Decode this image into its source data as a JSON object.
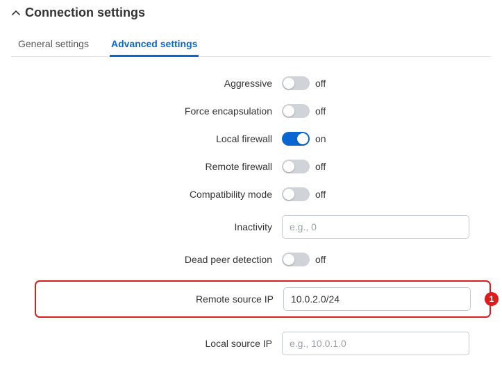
{
  "section": {
    "title": "Connection settings"
  },
  "tabs": {
    "general": "General settings",
    "advanced": "Advanced settings",
    "active": "advanced"
  },
  "form": {
    "aggressive": {
      "label": "Aggressive",
      "on": false,
      "state": "off"
    },
    "force_encapsulation": {
      "label": "Force encapsulation",
      "on": false,
      "state": "off"
    },
    "local_firewall": {
      "label": "Local firewall",
      "on": true,
      "state": "on"
    },
    "remote_firewall": {
      "label": "Remote firewall",
      "on": false,
      "state": "off"
    },
    "compatibility_mode": {
      "label": "Compatibility mode",
      "on": false,
      "state": "off"
    },
    "inactivity": {
      "label": "Inactivity",
      "value": "",
      "placeholder": "e.g., 0"
    },
    "dead_peer_detection": {
      "label": "Dead peer detection",
      "on": false,
      "state": "off"
    },
    "remote_source_ip": {
      "label": "Remote source IP",
      "value": "10.0.2.0/24",
      "placeholder": "",
      "highlighted": true,
      "badge": "1"
    },
    "local_source_ip": {
      "label": "Local source IP",
      "value": "",
      "placeholder": "e.g., 10.0.1.0"
    }
  }
}
